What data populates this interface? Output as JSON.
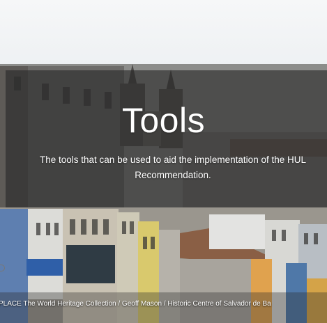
{
  "slide": {
    "title": "Tools",
    "description_line1": "The tools that can be used to aid the implementation of the HUL",
    "description_line2": "Recommendation.",
    "photo_credit": "PLACE The World Heritage Collection / Geoff Mason / Historic Centre of Salvador de Ba"
  },
  "colors": {
    "banner_overlay": "#282828",
    "text": "#ffffff",
    "sky": "#f4f5f6"
  }
}
